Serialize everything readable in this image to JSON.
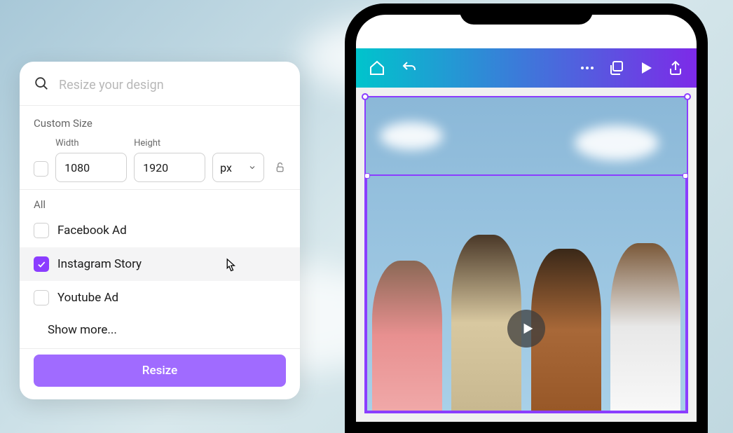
{
  "search": {
    "placeholder": "Resize your design"
  },
  "custom_size": {
    "section_label": "Custom Size",
    "width_label": "Width",
    "height_label": "Height",
    "width_value": "1080",
    "height_value": "1920",
    "unit": "px"
  },
  "all": {
    "label": "All",
    "options": [
      {
        "label": "Facebook Ad",
        "checked": false
      },
      {
        "label": "Instagram Story",
        "checked": true
      },
      {
        "label": "Youtube Ad",
        "checked": false
      }
    ],
    "show_more": "Show more..."
  },
  "resize_button": "Resize",
  "app_header_icons": {
    "home": "home-icon",
    "undo": "undo-icon",
    "more": "more-icon",
    "layers": "layers-icon",
    "play": "play-icon",
    "share": "share-icon"
  }
}
